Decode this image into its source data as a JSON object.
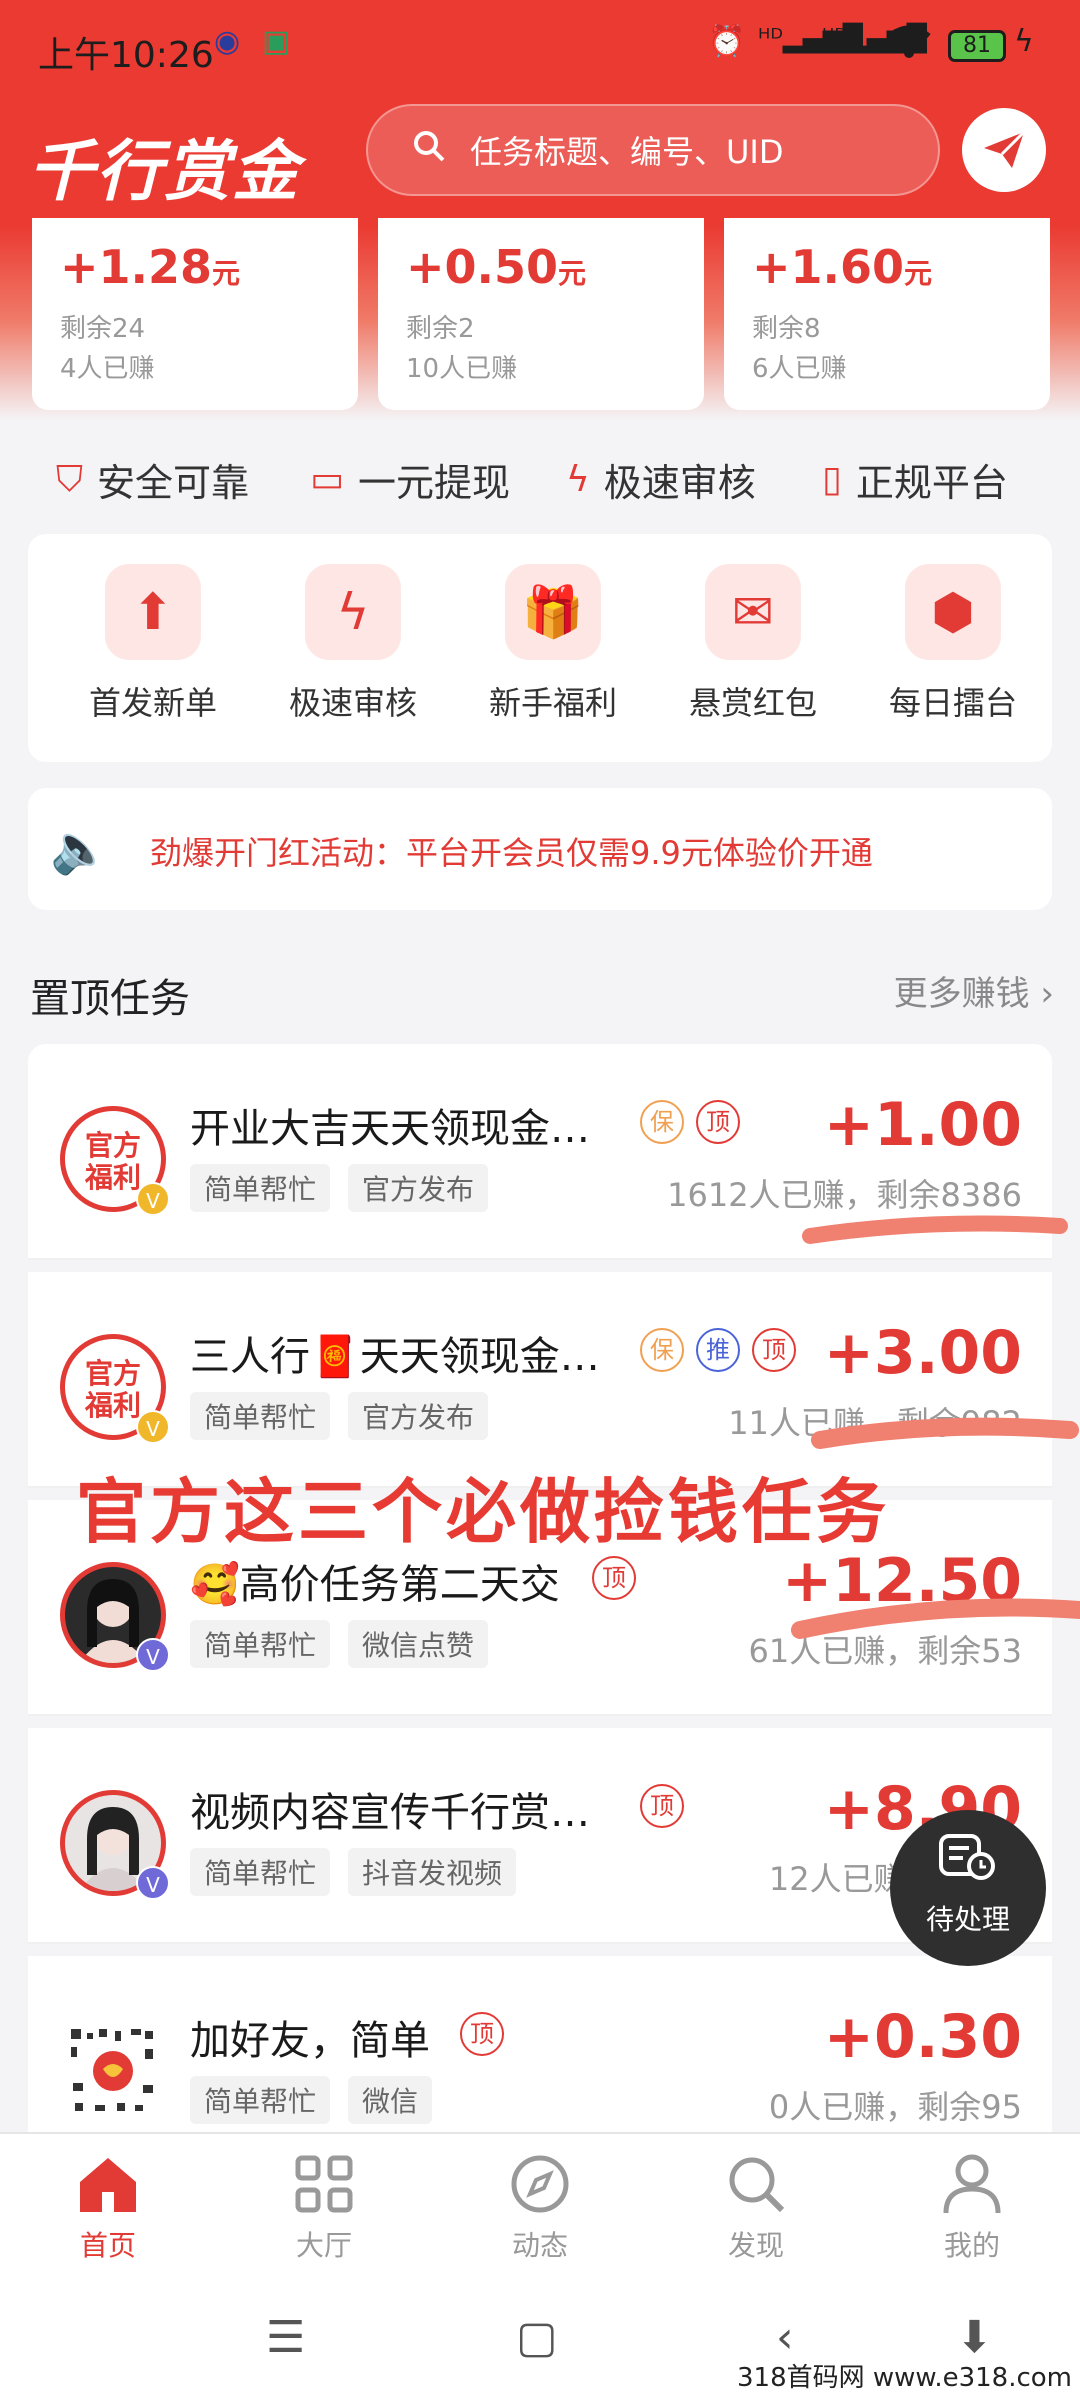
{
  "status_bar": {
    "time": "上午10:26",
    "battery": "81",
    "icons": [
      "app-badge-icon",
      "app-badge-icon-2",
      "alarm-icon",
      "hd-signal-icon",
      "hd-signal-icon-2",
      "wifi-icon",
      "battery-icon",
      "charging-icon"
    ]
  },
  "header": {
    "app_name": "千行赏金",
    "search_placeholder": "任务标题、编号、UID"
  },
  "top_cards": [
    {
      "amount": "+1.28",
      "unit": "元",
      "remaining": "剩余24",
      "earned": "4人已赚"
    },
    {
      "amount": "+0.50",
      "unit": "元",
      "remaining": "剩余2",
      "earned": "10人已赚"
    },
    {
      "amount": "+1.60",
      "unit": "元",
      "remaining": "剩余8",
      "earned": "6人已赚"
    }
  ],
  "features": [
    "安全可靠",
    "一元提现",
    "极速审核",
    "正规平台"
  ],
  "quick_actions": [
    "首发新单",
    "极速审核",
    "新手福利",
    "悬赏红包",
    "每日擂台"
  ],
  "notice": "劲爆开门红活动：平台开会员仅需9.9元体验价开通",
  "pinned": {
    "title": "置顶任务",
    "more": "更多赚钱"
  },
  "tasks": [
    {
      "title": "开业大吉天天领现金…",
      "tags": [
        "简单帮忙",
        "官方发布"
      ],
      "chips": [
        "保",
        "顶"
      ],
      "price": "+1.00",
      "stat": "1612人已赚，剩余8386",
      "avatar_text": "官方福利"
    },
    {
      "title": "三人行🧧天天领现金…",
      "tags": [
        "简单帮忙",
        "官方发布"
      ],
      "chips": [
        "保",
        "推",
        "顶"
      ],
      "price": "+3.00",
      "stat": "11人已赚，剩余982",
      "avatar_text": "官方福利"
    },
    {
      "title": "🥰高价任务第二天交",
      "tags": [
        "简单帮忙",
        "微信点赞"
      ],
      "chips": [
        "顶"
      ],
      "price": "+12.50",
      "stat": "61人已赚，剩余53",
      "avatar_text": ""
    },
    {
      "title": "视频内容宣传千行赏…",
      "tags": [
        "简单帮忙",
        "抖音发视频"
      ],
      "chips": [
        "顶"
      ],
      "price": "+8.90",
      "stat": "12人已赚，剩余8",
      "avatar_text": ""
    },
    {
      "title": "加好友，简单",
      "tags": [
        "简单帮忙",
        "微信"
      ],
      "chips": [
        "顶"
      ],
      "price": "+0.30",
      "stat": "0人已赚，剩余95",
      "avatar_text": ""
    }
  ],
  "overlay_text": "官方这三个必做捡钱任务",
  "pending_label": "待处理",
  "tabs": [
    "首页",
    "大厅",
    "动态",
    "发现",
    "我的"
  ],
  "watermark": "318首码网 www.e318.com",
  "colors": {
    "brand": "#ea3a32",
    "price": "#e23b36",
    "muted": "#999999"
  }
}
